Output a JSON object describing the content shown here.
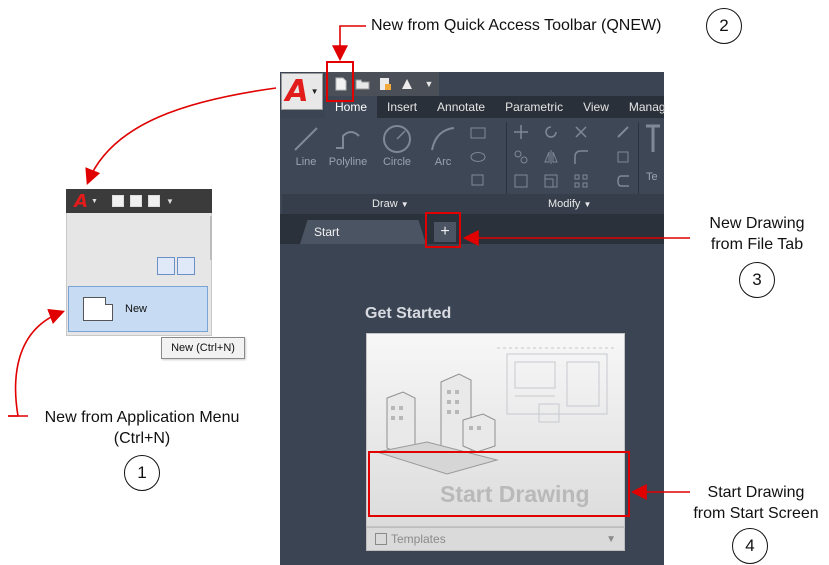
{
  "annotations": {
    "qat_callout": "New from Quick Access Toolbar (QNEW)",
    "qat_num": "2",
    "filetab_line1": "New Drawing",
    "filetab_line2": "from File Tab",
    "filetab_num": "3",
    "appmenu_line1": "New from Application Menu",
    "appmenu_line2": "(Ctrl+N)",
    "appmenu_num": "1",
    "startscreen_line1": "Start Drawing",
    "startscreen_line2": "from Start Screen",
    "startscreen_num": "4"
  },
  "app_menu": {
    "logo": "A",
    "new_label": "New",
    "tooltip": "New (Ctrl+N)"
  },
  "app": {
    "logo": "A",
    "ribbon_tabs": [
      "Home",
      "Insert",
      "Annotate",
      "Parametric",
      "View",
      "Manag"
    ],
    "draw_tools": [
      "Line",
      "Polyline",
      "Circle",
      "Arc"
    ],
    "draw_panel": "Draw",
    "modify_panel": "Modify",
    "partial_tool": "Te",
    "file_tab": "Start",
    "plus": "+",
    "get_started": "Get Started",
    "start_drawing": "Start Drawing",
    "templates": "Templates"
  },
  "colors": {
    "highlight": "#e00000",
    "arrow": "#e00000",
    "app_bg": "#3b4453"
  }
}
